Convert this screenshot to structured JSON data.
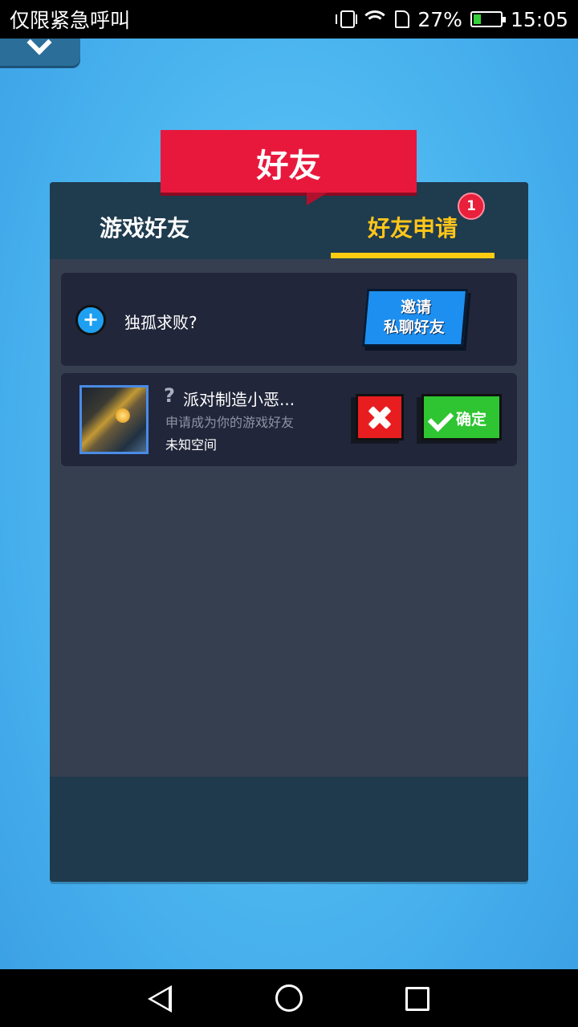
{
  "status_bar": {
    "carrier_text": "仅限紧急呼叫",
    "battery_percent": "27%",
    "time": "15:05",
    "icons": [
      "vibrate-icon",
      "wifi-icon",
      "sim-icon",
      "battery-charging-icon"
    ]
  },
  "header": {
    "title": "好友",
    "back_icon": "back-arrow-icon"
  },
  "tabs": [
    {
      "label": "游戏好友",
      "active": false
    },
    {
      "label": "好友申请",
      "active": true,
      "badge": "1"
    }
  ],
  "invite_card": {
    "icon": "plus-icon",
    "prompt": "独孤求败?",
    "button_line1": "邀请",
    "button_line2": "私聊好友"
  },
  "requests": [
    {
      "unknown_icon": "?",
      "name": "派对制造小恶...",
      "message": "申请成为你的游戏好友",
      "location": "未知空间",
      "reject_icon": "close-icon",
      "accept_label": "确定",
      "accept_icon": "check-icon"
    }
  ],
  "colors": {
    "title_banner": "#e8183d",
    "active_tab": "#ffc61a",
    "invite_button": "#1d8ff0",
    "reject_button": "#e81d1f",
    "accept_button": "#2fc432",
    "background": "#4ab4ef"
  }
}
